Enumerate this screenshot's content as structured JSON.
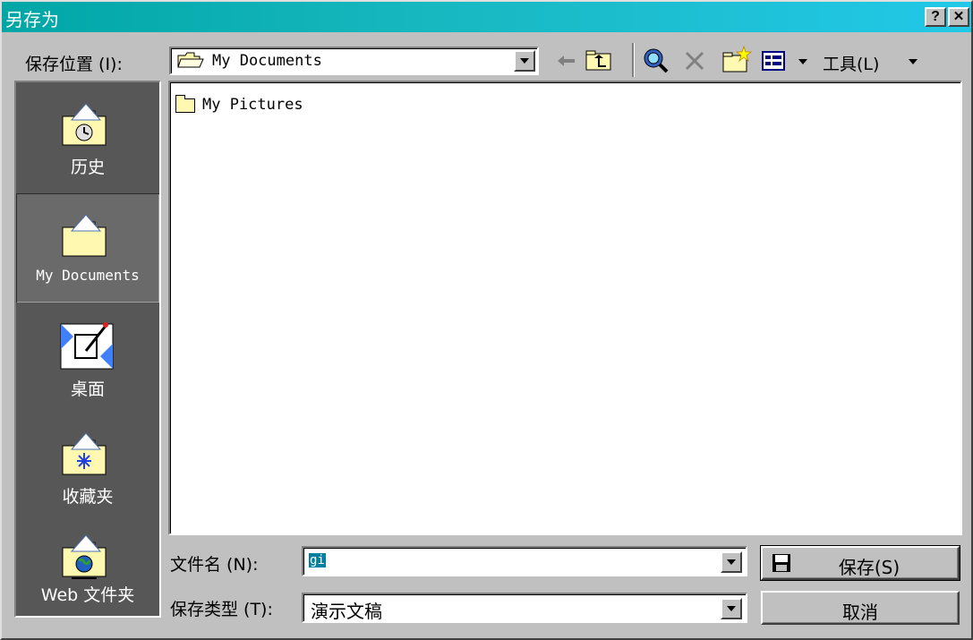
{
  "window": {
    "title": "另存为",
    "help_button": "?",
    "close_button": "✕"
  },
  "toolbar": {
    "save_in_label": "保存位置 (I):",
    "location_value": "My Documents",
    "tools_label": "工具(L)"
  },
  "places": [
    {
      "label": "历史",
      "icon": "history-icon"
    },
    {
      "label": "My Documents",
      "icon": "my-documents-icon",
      "selected": true
    },
    {
      "label": "桌面",
      "icon": "desktop-icon"
    },
    {
      "label": "收藏夹",
      "icon": "favorites-icon"
    },
    {
      "label": "Web 文件夹",
      "icon": "web-folders-icon"
    }
  ],
  "files": [
    {
      "name": "My Pictures",
      "icon": "folder-icon"
    }
  ],
  "form": {
    "filename_label": "文件名 (N):",
    "filename_value": "gi",
    "filetype_label": "保存类型 (T):",
    "filetype_value": "演示文稿",
    "save_button": "保存(S)",
    "cancel_button": "取消"
  }
}
